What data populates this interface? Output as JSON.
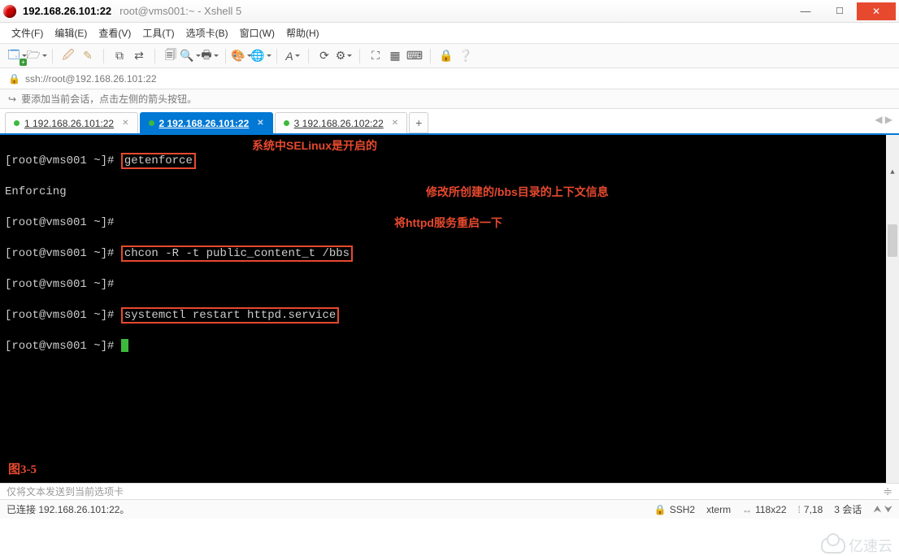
{
  "titlebar": {
    "host": "192.168.26.101:22",
    "subtitle": "root@vms001:~ - Xshell 5"
  },
  "menubar": {
    "file": "文件(F)",
    "edit": "编辑(E)",
    "view": "查看(V)",
    "tools": "工具(T)",
    "tabs": "选项卡(B)",
    "window": "窗口(W)",
    "help": "帮助(H)"
  },
  "addrbar": {
    "url": "ssh://root@192.168.26.101:22"
  },
  "hintbar": {
    "text": "要添加当前会话，点击左侧的箭头按钮。"
  },
  "tabs": {
    "t1": "1 192.168.26.101:22",
    "t2": "2 192.168.26.101:22",
    "t3": "3 192.168.26.102:22",
    "add": "+"
  },
  "terminal": {
    "p1": "[root@vms001 ~]# ",
    "cmd1": "getenforce",
    "ann1": "系统中SELinux是开启的",
    "out1": "Enforcing",
    "p2": "[root@vms001 ~]#",
    "p3": "[root@vms001 ~]# ",
    "cmd2": "chcon -R -t public_content_t /bbs",
    "ann2": "修改所创建的/bbs目录的上下文信息",
    "p4": "[root@vms001 ~]#",
    "p5": "[root@vms001 ~]# ",
    "cmd3": "systemctl restart httpd.service",
    "ann3": "将httpd服务重启一下",
    "p6": "[root@vms001 ~]# ",
    "figlabel": "图3-5"
  },
  "sendbar": {
    "placeholder": "仅将文本发送到当前选项卡"
  },
  "statusbar": {
    "conn": "已连接 192.168.26.101:22。",
    "proto": "SSH2",
    "term": "xterm",
    "size": "118x22",
    "pos": "7,18",
    "sessions": "3 会话"
  },
  "watermark": {
    "text": "亿速云"
  }
}
